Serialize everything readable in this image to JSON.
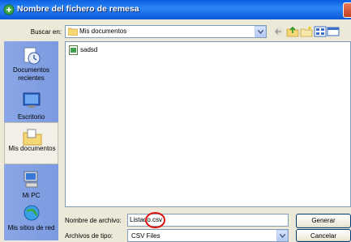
{
  "window": {
    "title": "Nombre del fichero de remesa",
    "title_icon": "app-icon",
    "close_icon": "close-icon"
  },
  "lookin": {
    "label": "Buscar en:",
    "value": "Mis documentos",
    "icon": "folder-icon"
  },
  "toolbar": {
    "icons": [
      "back-icon",
      "up-folder-icon",
      "new-folder-icon",
      "view-menu-icon"
    ]
  },
  "places": [
    {
      "label": "Documentos recientes",
      "icon": "recent-documents-icon"
    },
    {
      "label": "Escritorio",
      "icon": "desktop-icon"
    },
    {
      "label": "Mis documentos",
      "icon": "my-documents-icon",
      "selected": true
    },
    {
      "label": "Mi PC",
      "icon": "my-computer-icon"
    },
    {
      "label": "Mis sitios de red",
      "icon": "network-places-icon"
    }
  ],
  "files": [
    {
      "name": "sadsd",
      "icon": "file-icon"
    }
  ],
  "filename": {
    "label": "Nombre de archivo:",
    "value": "Listado.csv"
  },
  "filetype": {
    "label": "Archivos de tipo:",
    "value": "CSV Files"
  },
  "buttons": {
    "ok": "Generar",
    "cancel": "Cancelar"
  },
  "colors": {
    "titlebar": "#0a5fe0",
    "places_bar": "#7b9ae0",
    "highlight_circle": "#e01010"
  }
}
